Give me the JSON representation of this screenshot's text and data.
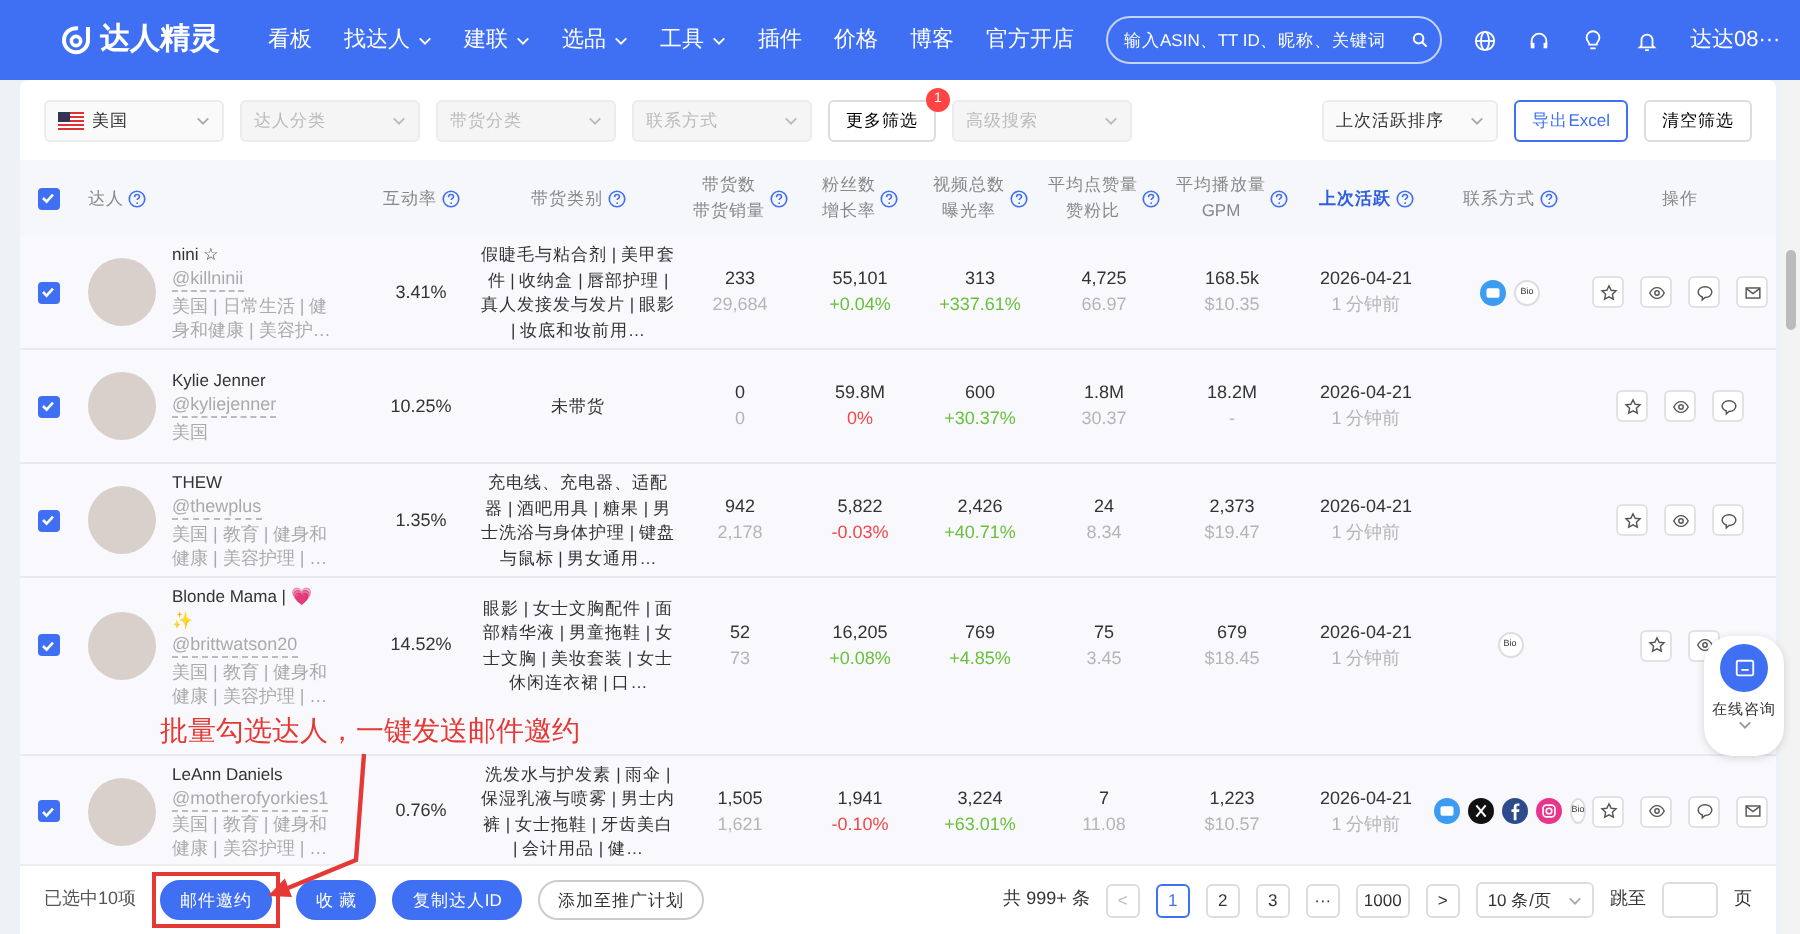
{
  "nav": {
    "logo": "达人精灵",
    "items": [
      {
        "label": "看板",
        "dropdown": false
      },
      {
        "label": "找达人",
        "dropdown": true
      },
      {
        "label": "建联",
        "dropdown": true
      },
      {
        "label": "选品",
        "dropdown": true
      },
      {
        "label": "工具",
        "dropdown": true
      },
      {
        "label": "插件",
        "dropdown": false
      },
      {
        "label": "价格",
        "dropdown": false
      },
      {
        "label": "博客",
        "dropdown": false
      },
      {
        "label": "官方开店",
        "dropdown": false
      }
    ],
    "search": {
      "placeholder": "输入ASIN、TT ID、昵称、关键词"
    },
    "user": "达达08···"
  },
  "filters": {
    "country": "美国",
    "selects": [
      {
        "placeholder": "达人分类"
      },
      {
        "placeholder": "带货分类"
      },
      {
        "placeholder": "联系方式"
      }
    ],
    "more": {
      "label": "更多筛选",
      "badge": "1"
    },
    "advanced": {
      "placeholder": "高级搜索"
    },
    "sort": "上次活跃排序",
    "export": "导出Excel",
    "clear": "清空筛选"
  },
  "table": {
    "header_checked": true,
    "columns": [
      {
        "labels": [
          "达人"
        ],
        "help": true,
        "active": false
      },
      {
        "labels": [
          "互动率"
        ],
        "help": true,
        "active": false
      },
      {
        "labels": [
          "带货类别"
        ],
        "help": true,
        "active": false
      },
      {
        "labels": [
          "带货数",
          "带货销量"
        ],
        "help": true,
        "active": false
      },
      {
        "labels": [
          "粉丝数",
          "增长率"
        ],
        "help": true,
        "active": false
      },
      {
        "labels": [
          "视频总数",
          "曝光率"
        ],
        "help": true,
        "active": false
      },
      {
        "labels": [
          "平均点赞量",
          "赞粉比"
        ],
        "help": true,
        "active": false
      },
      {
        "labels": [
          "平均播放量",
          "GPM"
        ],
        "help": true,
        "active": false
      },
      {
        "labels": [
          "上次活跃"
        ],
        "help": true,
        "active": true
      },
      {
        "labels": [
          "联系方式"
        ],
        "help": true,
        "active": false
      },
      {
        "labels": [
          "操作"
        ],
        "help": false,
        "active": false
      }
    ],
    "rows": [
      {
        "selected": true,
        "name": "nini ☆",
        "handle": "@killninii",
        "tags": "美国 | 日常生活 | 健身和健康 | 美容护…",
        "engagement": "3.41%",
        "categories": "假睫毛与粘合剂 | 美甲套件 | 收纳盒 | 唇部护理 | 真人发接发与发片 | 眼影 | 妆底和妆前用…",
        "sales": "233",
        "sales_volume": "29,684",
        "fans": "55,101",
        "fans_growth": {
          "text": "+0.04%",
          "negative": false
        },
        "videos": "313",
        "exposure": {
          "text": "+337.61%",
          "negative": false
        },
        "likes": "4,725",
        "like_ratio": "66.97",
        "views": "168.5k",
        "gpm": "$10.35",
        "last_active": "2026-04-21",
        "ago": "1 分钟前",
        "contacts": [
          {
            "kind": "email"
          },
          {
            "kind": "bio",
            "label": "Bio"
          }
        ],
        "actions": [
          {
            "kind": "star"
          },
          {
            "kind": "eye"
          },
          {
            "kind": "comment"
          },
          {
            "kind": "mail"
          }
        ]
      },
      {
        "selected": true,
        "name": "Kylie Jenner",
        "handle": "@kyliejenner",
        "tags": "美国",
        "engagement": "10.25%",
        "categories": "未带货",
        "sales": "0",
        "sales_volume": "0",
        "fans": "59.8M",
        "fans_growth": {
          "text": "0%",
          "negative": true
        },
        "videos": "600",
        "exposure": {
          "text": "+30.37%",
          "negative": false
        },
        "likes": "1.8M",
        "like_ratio": "30.37",
        "views": "18.2M",
        "gpm": "-",
        "last_active": "2026-04-21",
        "ago": "1 分钟前",
        "contacts": [],
        "actions": [
          {
            "kind": "star"
          },
          {
            "kind": "eye"
          },
          {
            "kind": "comment"
          }
        ]
      },
      {
        "selected": true,
        "name": "THEW",
        "handle": "@thewplus",
        "tags": "美国 | 教育 | 健身和健康 | 美容护理 | …",
        "engagement": "1.35%",
        "categories": "充电线、充电器、适配器 | 酒吧用具 | 糖果 | 男士洗浴与身体护理 | 键盘与鼠标 | 男女通用…",
        "sales": "942",
        "sales_volume": "2,178",
        "fans": "5,822",
        "fans_growth": {
          "text": "-0.03%",
          "negative": true
        },
        "videos": "2,426",
        "exposure": {
          "text": "+40.71%",
          "negative": false
        },
        "likes": "24",
        "like_ratio": "8.34",
        "views": "2,373",
        "gpm": "$19.47",
        "last_active": "2026-04-21",
        "ago": "1 分钟前",
        "contacts": [],
        "actions": [
          {
            "kind": "star"
          },
          {
            "kind": "eye"
          },
          {
            "kind": "comment"
          }
        ]
      },
      {
        "selected": true,
        "name": "Blonde Mama | 💗 ✨",
        "handle": "@brittwatson20",
        "tags": "美国 | 教育 | 健身和健康 | 美容护理 | …",
        "engagement": "14.52%",
        "categories": "眼影 | 女士文胸配件 | 面部精华液 | 男童拖鞋 | 女士文胸 | 美妆套装 | 女士休闲连衣裙 | 口…",
        "sales": "52",
        "sales_volume": "73",
        "fans": "16,205",
        "fans_growth": {
          "text": "+0.08%",
          "negative": false
        },
        "videos": "769",
        "exposure": {
          "text": "+4.85%",
          "negative": false
        },
        "likes": "75",
        "like_ratio": "3.45",
        "views": "679",
        "gpm": "$18.45",
        "last_active": "2026-04-21",
        "ago": "1 分钟前",
        "contacts": [
          {
            "kind": "bio",
            "label": "Bio"
          }
        ],
        "actions": [
          {
            "kind": "star"
          },
          {
            "kind": "eye"
          }
        ],
        "annotation": "批量勾选达人，一键发送邮件邀约"
      },
      {
        "selected": true,
        "name": "LeAnn Daniels",
        "handle": "@motherofyorkies1",
        "tags": "美国 | 教育 | 健身和健康 | 美容护理 | …",
        "engagement": "0.76%",
        "categories": "洗发水与护发素 | 雨伞 | 保湿乳液与喷雾 | 男士内裤 | 女士拖鞋 | 牙齿美白 | 会计用品 | 健…",
        "sales": "1,505",
        "sales_volume": "1,621",
        "fans": "1,941",
        "fans_growth": {
          "text": "-0.10%",
          "negative": true
        },
        "videos": "3,224",
        "exposure": {
          "text": "+63.01%",
          "negative": false
        },
        "likes": "7",
        "like_ratio": "11.08",
        "views": "1,223",
        "gpm": "$10.57",
        "last_active": "2026-04-21",
        "ago": "1 分钟前",
        "contacts": [
          {
            "kind": "email"
          },
          {
            "kind": "x"
          },
          {
            "kind": "facebook"
          },
          {
            "kind": "instagram"
          },
          {
            "kind": "bio",
            "label": "Bio"
          }
        ],
        "actions": [
          {
            "kind": "star"
          },
          {
            "kind": "eye"
          },
          {
            "kind": "comment"
          },
          {
            "kind": "mail"
          }
        ]
      }
    ]
  },
  "footer": {
    "selected_count": "已选中10项",
    "buttons": [
      {
        "label": "邮件邀约",
        "kind": "primary",
        "highlighted": true
      },
      {
        "label": "收 藏",
        "kind": "primary",
        "highlighted": false
      },
      {
        "label": "复制达人ID",
        "kind": "primary",
        "highlighted": false
      },
      {
        "label": "添加至推广计划",
        "kind": "outline",
        "highlighted": false
      }
    ],
    "pagination": {
      "total": "共 999+ 条",
      "pages": [
        {
          "label": "1",
          "selected": true
        },
        {
          "label": "2",
          "selected": false
        },
        {
          "label": "3",
          "selected": false
        },
        {
          "label": "···",
          "selected": false
        },
        {
          "label": "1000",
          "selected": false
        }
      ],
      "prev": "<",
      "next": ">",
      "page_size": "10 条/页",
      "jump": "跳至",
      "page_unit": "页"
    }
  },
  "chat_widget": {
    "label": "在线咨询"
  }
}
